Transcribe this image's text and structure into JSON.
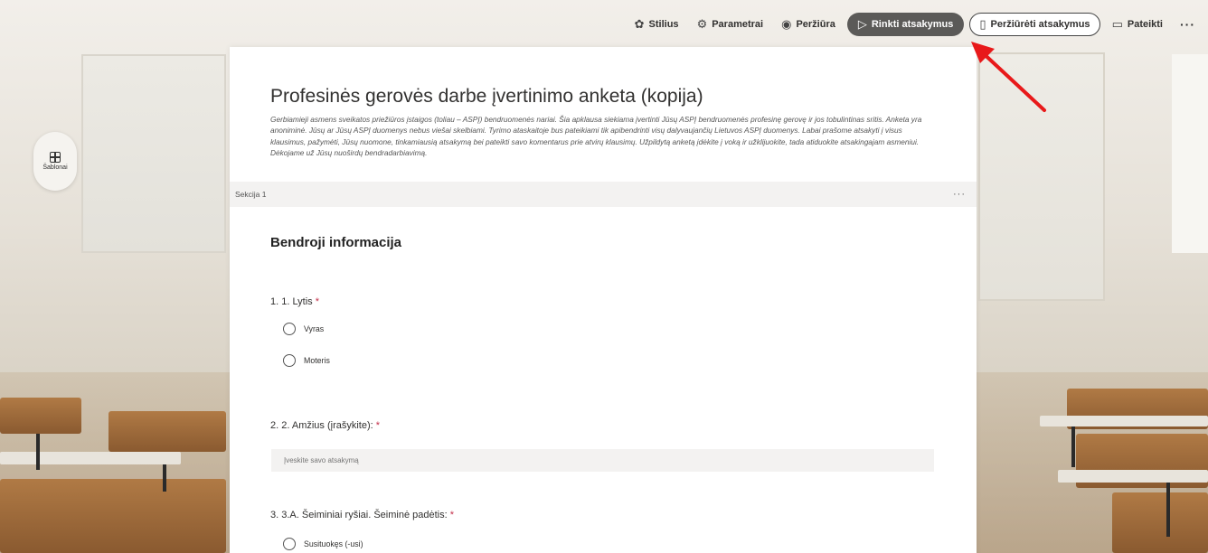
{
  "toolbar": {
    "style_label": "Stilius",
    "settings_label": "Parametrai",
    "preview_label": "Peržiūra",
    "collect_label": "Rinkti atsakymus",
    "view_responses_label": "Peržiūrėti atsakymus",
    "present_label": "Pateikti",
    "more_label": "···"
  },
  "sidebar": {
    "templates_label": "Šablonai"
  },
  "form": {
    "title": "Profesinės gerovės darbe įvertinimo anketa (kopija)",
    "description": "Gerbiamieji asmens sveikatos priežiūros įstaigos (toliau – ASPĮ) bendruomenės nariai.  Šia apklausa siekiama įvertinti Jūsų ASPĮ bendruomenės profesinę gerovę ir jos tobulintinas sritis. Anketa yra anoniminė. Jūsų ar Jūsų ASPĮ duomenys nebus viešai skelbiami. Tyrimo ataskaitoje bus pateikiami tik apibendrinti visų dalyvaujančių Lietuvos ASPĮ duomenys.   Labai prašome atsakyti į visus klausimus, pažymėti, Jūsų nuomone, tinkamiausią atsakymą bei pateikti savo komentarus prie atvirų klausimų. Užpildytą anketą įdėkite į voką ir užklijuokite, tada atiduokite atsakingajam asmeniui. Dėkojame už Jūsų nuoširdų bendradarbiavimą.",
    "section_label": "Sekcija 1",
    "section_more": "···",
    "section_heading": "Bendroji informacija",
    "required_mark": "*",
    "questions": [
      {
        "label": "1. 1. Lytis",
        "options": [
          "Vyras",
          "Moteris"
        ]
      },
      {
        "label": "2. 2. Amžius (įrašykite):",
        "placeholder": "Įveskite savo atsakymą"
      },
      {
        "label": "3. 3.A. Šeiminiai ryšiai. Šeiminė padėtis:",
        "options": [
          "Susituokęs (-usi)"
        ]
      }
    ]
  },
  "colors": {
    "primary_button": "#5b5a58",
    "required": "#c4314b",
    "annotation_arrow": "#e8191a"
  }
}
